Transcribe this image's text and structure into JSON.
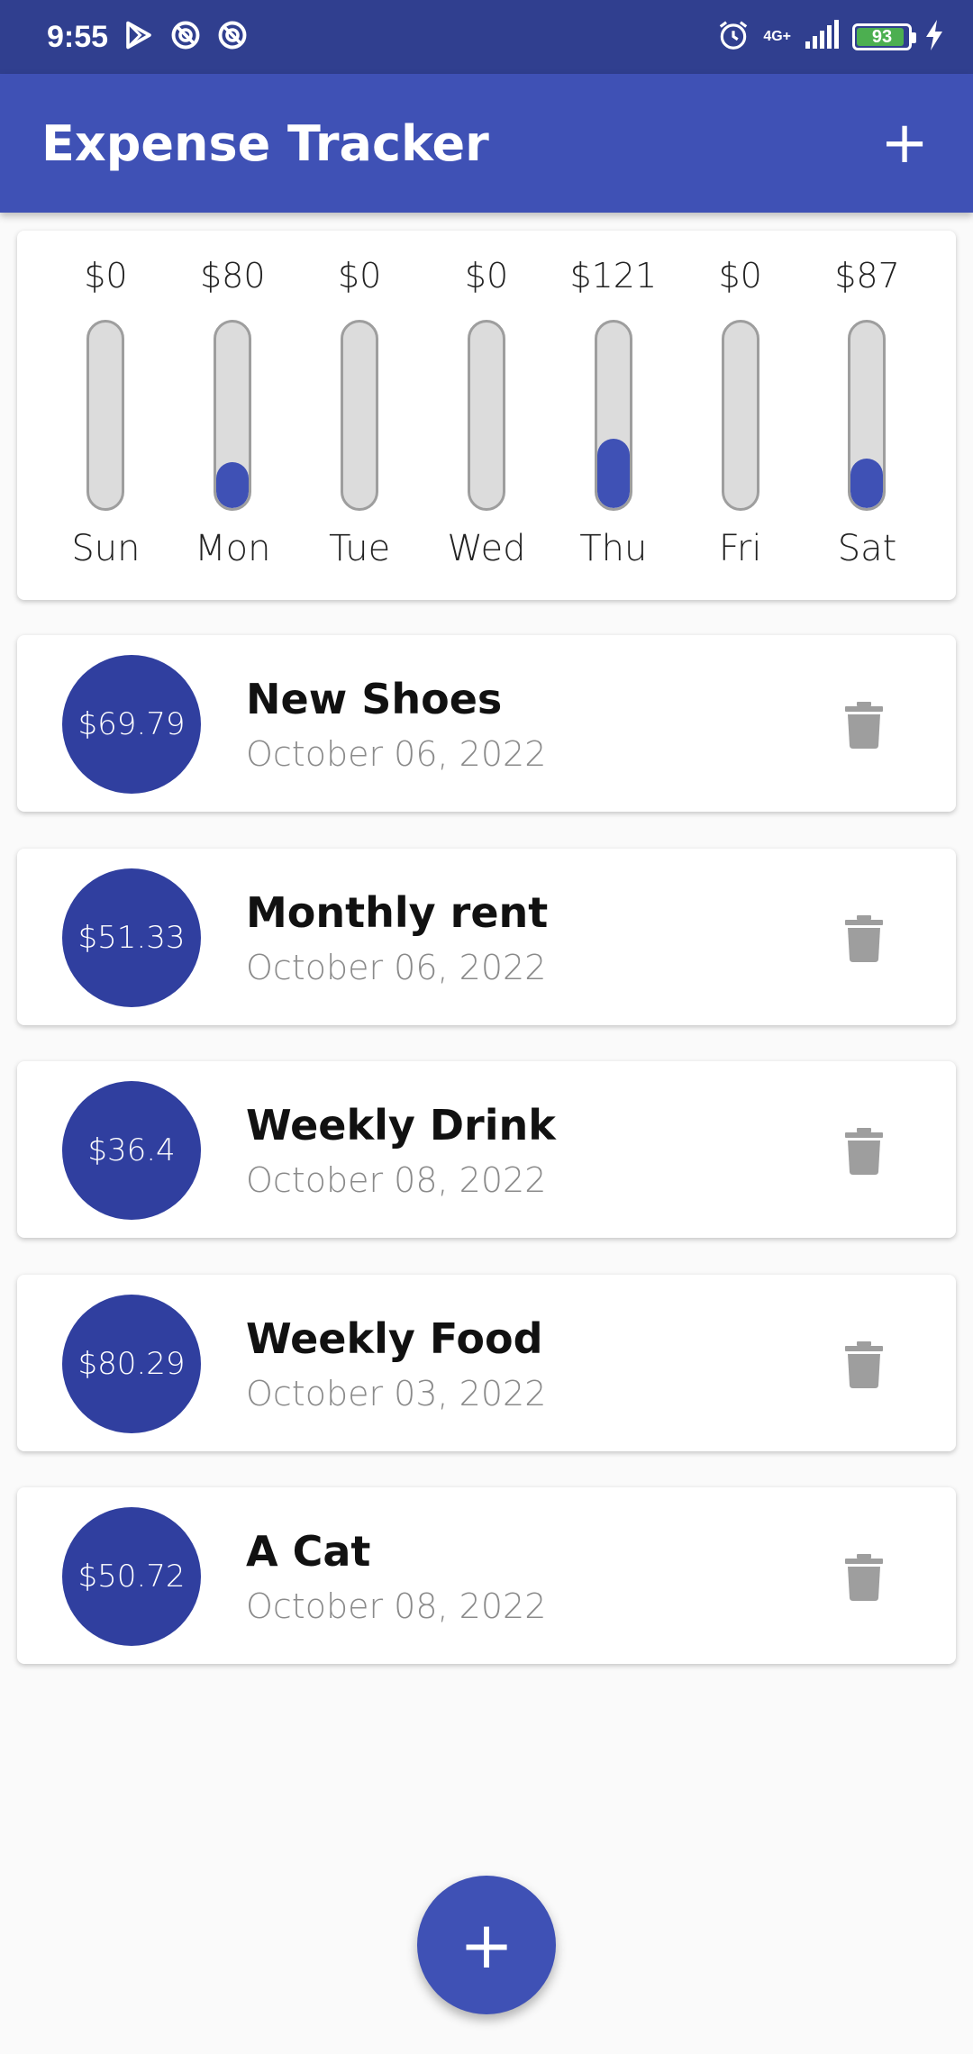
{
  "status_bar": {
    "time": "9:55",
    "network": "4G+",
    "battery": "93",
    "icons": [
      "play-store-icon",
      "sync-icon",
      "sync-icon",
      "alarm-icon",
      "signal-icon",
      "battery-icon",
      "charging-icon"
    ]
  },
  "app_bar": {
    "title": "Expense Tracker",
    "add_label": "+"
  },
  "chart_data": {
    "type": "bar",
    "categories": [
      "Sun",
      "Mon",
      "Tue",
      "Wed",
      "Thu",
      "Fri",
      "Sat"
    ],
    "amounts": [
      "$0",
      "$80",
      "$0",
      "$0",
      "$121",
      "$0",
      "$87"
    ],
    "values": [
      0,
      80,
      0,
      0,
      121,
      0,
      87
    ],
    "max_value": 325,
    "bar_color": "#3f51b5"
  },
  "transactions": [
    {
      "amount": "$69.79",
      "title": "New Shoes",
      "date": "October 06, 2022"
    },
    {
      "amount": "$51.33",
      "title": "Monthly rent",
      "date": "October 06, 2022"
    },
    {
      "amount": "$36.4",
      "title": "Weekly Drink",
      "date": "October 08, 2022"
    },
    {
      "amount": "$80.29",
      "title": "Weekly Food",
      "date": "October 03, 2022"
    },
    {
      "amount": "$50.72",
      "title": "A Cat",
      "date": "October 08, 2022"
    }
  ],
  "fab": {
    "label": "+"
  },
  "colors": {
    "primary": "#3f51b5",
    "primary_dark": "#303f9f",
    "status_bar": "#303f8f",
    "delete_icon": "#9e9e9e"
  }
}
